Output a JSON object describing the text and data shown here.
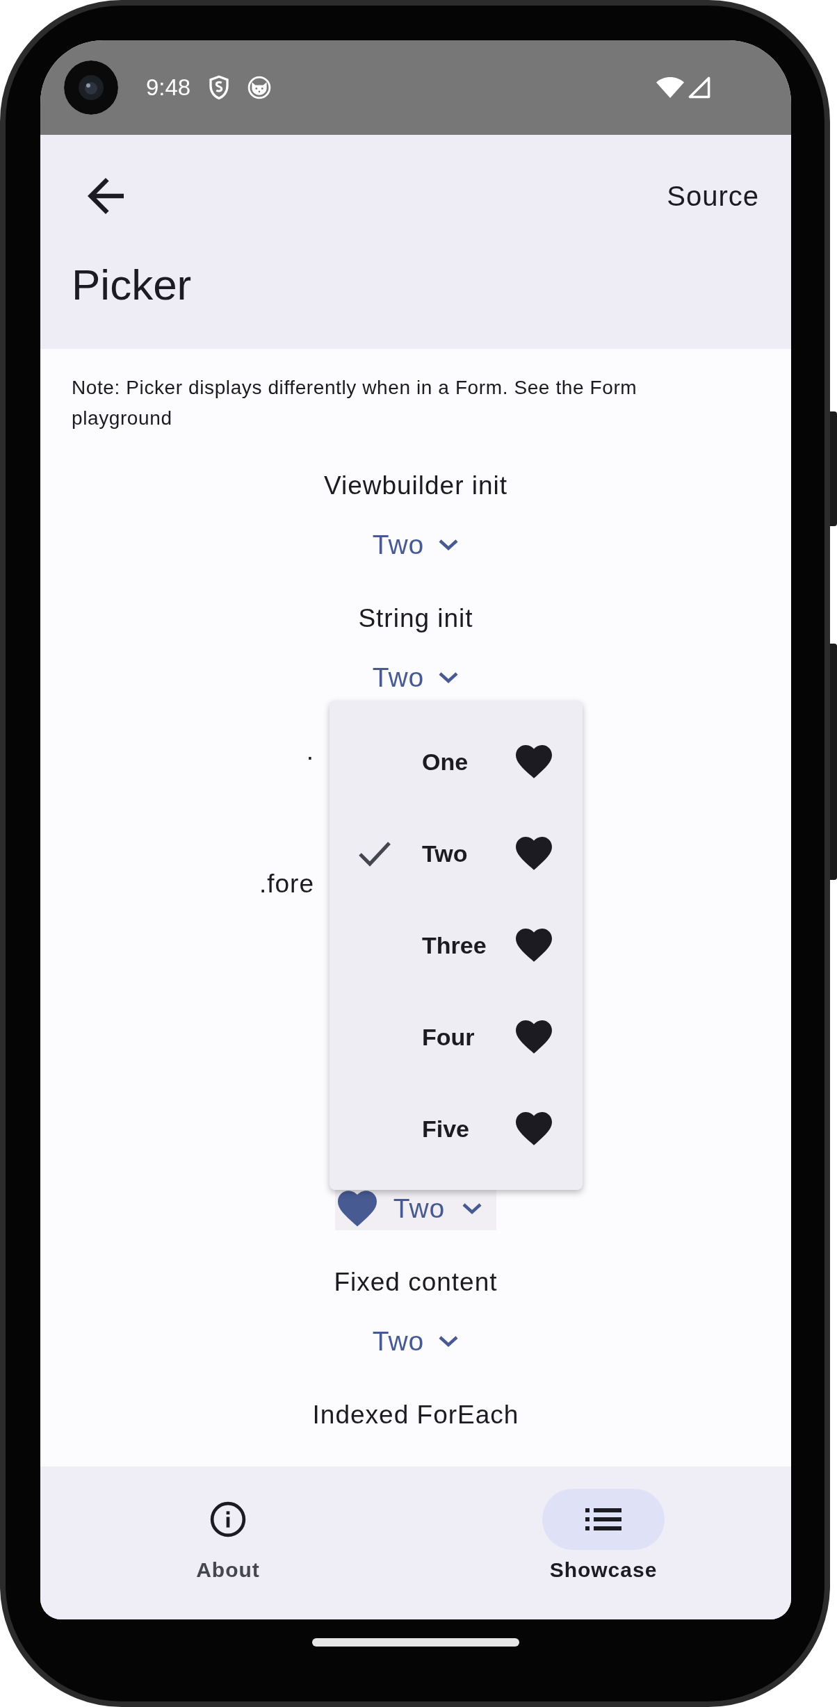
{
  "status_bar": {
    "time": "9:48"
  },
  "app_bar": {
    "action": "Source",
    "title": "Picker"
  },
  "note": "Note: Picker displays differently when in a Form. See the Form playground",
  "sections": [
    {
      "label": "Viewbuilder init",
      "cut_by_menu": false,
      "picker": {
        "kind": "plain",
        "value": "Two"
      }
    },
    {
      "label": "String init",
      "cut_by_menu": false,
      "picker": {
        "kind": "plain",
        "value": "Two"
      }
    },
    {
      "label": ".",
      "cut_by_menu": true
    },
    {
      "label": ".fore",
      "cut_by_menu": true
    },
    {
      "picker": {
        "kind": "icon",
        "value": "Two"
      }
    },
    {
      "label": "Fixed content",
      "cut_by_menu": false,
      "picker": {
        "kind": "plain",
        "value": "Two"
      }
    },
    {
      "label": "Indexed ForEach",
      "cut_by_menu": false
    }
  ],
  "menu": {
    "items": [
      {
        "label": "One",
        "selected": false
      },
      {
        "label": "Two",
        "selected": true
      },
      {
        "label": "Three",
        "selected": false
      },
      {
        "label": "Four",
        "selected": false
      },
      {
        "label": "Five",
        "selected": false
      }
    ]
  },
  "bottom_nav": [
    {
      "label": "About",
      "selected": false
    },
    {
      "label": "Showcase",
      "selected": true
    }
  ]
}
